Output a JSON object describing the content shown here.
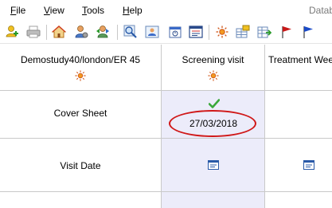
{
  "menu": {
    "items": [
      {
        "label": "File",
        "underline": "F",
        "rest": "ile"
      },
      {
        "label": "View",
        "underline": "V",
        "rest": "iew"
      },
      {
        "label": "Tools",
        "underline": "T",
        "rest": "ools"
      },
      {
        "label": "Help",
        "underline": "H",
        "rest": "elp"
      }
    ],
    "app_title": "Datab"
  },
  "toolbar": {
    "buttons": [
      {
        "name": "add-patient-icon"
      },
      {
        "name": "print-icon"
      },
      {
        "name": "home-icon"
      },
      {
        "name": "user-settings-icon"
      },
      {
        "name": "transfer-icon"
      },
      {
        "name": "search-icon"
      },
      {
        "name": "user-card-icon"
      },
      {
        "name": "calendar-icon"
      },
      {
        "name": "form-icon"
      },
      {
        "name": "sun-icon"
      },
      {
        "name": "table-edit-icon"
      },
      {
        "name": "table-export-icon"
      },
      {
        "name": "red-flag-icon"
      },
      {
        "name": "blue-flag-icon"
      }
    ]
  },
  "grid": {
    "header": {
      "patient": "Demostudy40/london/ER 45",
      "visits": [
        "Screening visit",
        "Treatment Wee"
      ]
    },
    "rows": [
      {
        "label": "Cover Sheet",
        "screening_value": "27/03/2018",
        "screening_status": "check-icon"
      },
      {
        "label": "Visit Date"
      }
    ]
  },
  "colors": {
    "active_column": "#ececfa",
    "highlight": "#d01818",
    "check": "#3aa83a",
    "sun": "#e8731a"
  }
}
